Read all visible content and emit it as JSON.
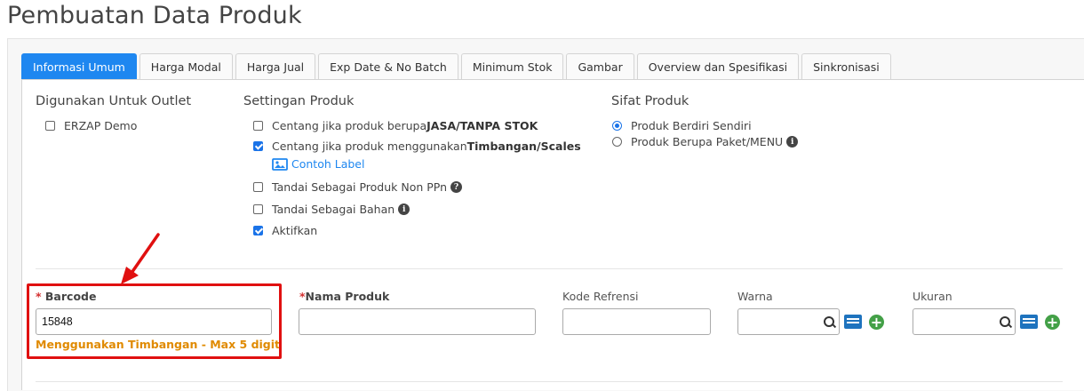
{
  "page_title": "Pembuatan Data Produk",
  "tabs": [
    {
      "label": "Informasi Umum",
      "active": true
    },
    {
      "label": "Harga Modal"
    },
    {
      "label": "Harga Jual"
    },
    {
      "label": "Exp Date & No Batch"
    },
    {
      "label": "Minimum Stok"
    },
    {
      "label": "Gambar"
    },
    {
      "label": "Overview dan Spesifikasi"
    },
    {
      "label": "Sinkronisasi"
    }
  ],
  "outlet": {
    "title": "Digunakan Untuk Outlet",
    "items": [
      {
        "label": "ERZAP Demo",
        "checked": false
      }
    ]
  },
  "settings": {
    "title": "Settingan Produk",
    "jasa": {
      "prefix": "Centang jika produk berupa ",
      "bold": "JASA/TANPA STOK",
      "checked": false
    },
    "timbangan": {
      "prefix": "Centang jika produk menggunakan ",
      "bold": "Timbangan/Scales",
      "checked": true
    },
    "contoh_label": "Contoh Label",
    "non_ppn": {
      "label": "Tandai Sebagai Produk Non PPn",
      "checked": false
    },
    "bahan": {
      "label": "Tandai Sebagai Bahan",
      "checked": false
    },
    "aktifkan": {
      "label": "Aktifkan",
      "checked": true
    }
  },
  "sifat": {
    "title": "Sifat Produk",
    "options": [
      {
        "label": "Produk Berdiri Sendiri",
        "selected": true
      },
      {
        "label": "Produk Berupa Paket/MENU",
        "selected": false
      }
    ]
  },
  "fields": {
    "barcode": {
      "required_mark": "*",
      "label": "Barcode",
      "value": "15848",
      "hint": "Menggunakan Timbangan - Max 5 digit"
    },
    "nama_produk": {
      "required_mark": "*",
      "label": "Nama Produk",
      "value": ""
    },
    "kode_referensi": {
      "label": "Kode Refrensi",
      "value": ""
    },
    "warna": {
      "label": "Warna",
      "value": ""
    },
    "ukuran": {
      "label": "Ukuran",
      "value": ""
    }
  },
  "colors": {
    "accent": "#1e87f0",
    "warning": "#e08a00",
    "highlight": "#e01010",
    "add": "#43a047"
  }
}
